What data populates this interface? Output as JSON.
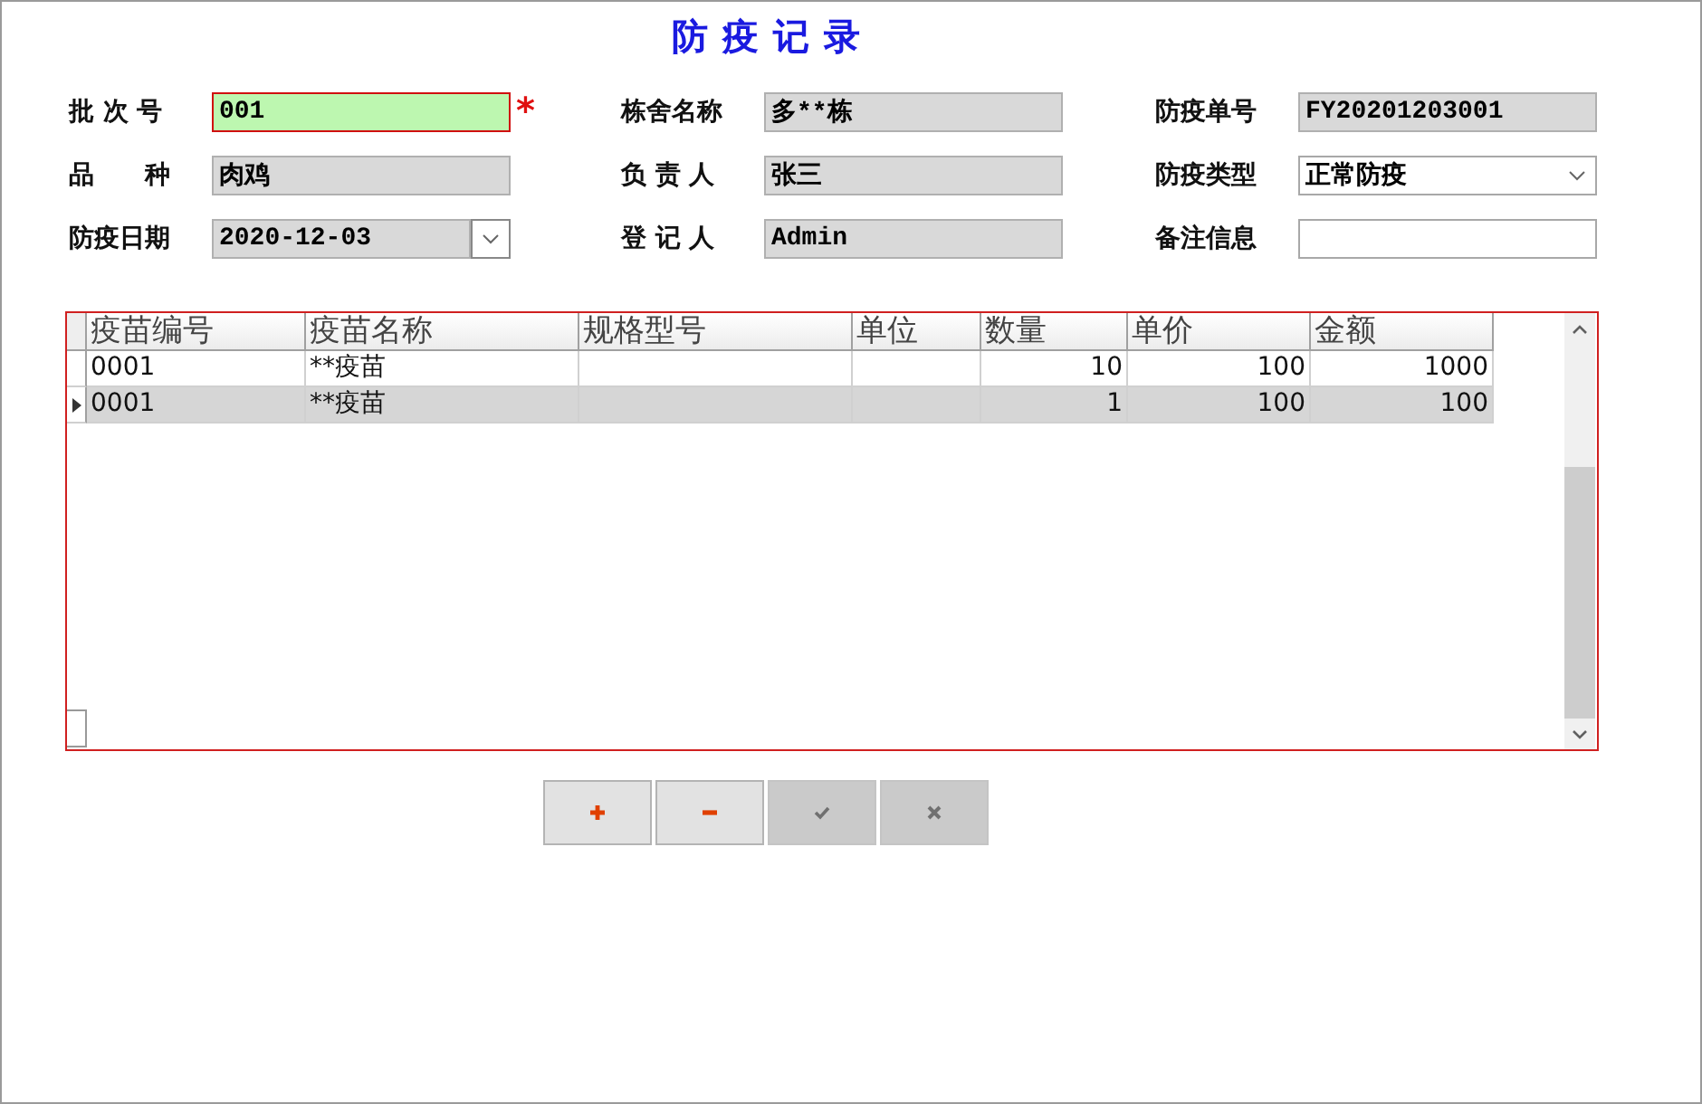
{
  "window": {
    "title": "防疫记录"
  },
  "form": {
    "fields": [
      {
        "label": "批 次 号",
        "kind": "text",
        "value": "001",
        "focused": true,
        "readonly": false,
        "mark": "*"
      },
      {
        "label": "栋舍名称",
        "kind": "text",
        "value": "多**栋",
        "focused": false,
        "readonly": true
      },
      {
        "label": "防疫单号",
        "kind": "text",
        "value": "FY20201203001",
        "focused": false,
        "readonly": true
      },
      {
        "label": "品　　种",
        "kind": "text",
        "value": "肉鸡",
        "focused": false,
        "readonly": true
      },
      {
        "label": "负 责 人",
        "kind": "text",
        "value": "张三",
        "focused": false,
        "readonly": true
      },
      {
        "label": "防疫类型",
        "kind": "combo",
        "value": "正常防疫",
        "focused": false,
        "readonly": false
      },
      {
        "label": "防疫日期",
        "kind": "date",
        "value": "2020-12-03",
        "focused": false,
        "readonly": true
      },
      {
        "label": "登 记 人",
        "kind": "text",
        "value": "Admin",
        "focused": false,
        "readonly": true
      },
      {
        "label": "备注信息",
        "kind": "text",
        "focused": false,
        "readonly": false
      }
    ]
  },
  "grid": {
    "columns": [
      {
        "label": "疫苗编号",
        "kind": "text"
      },
      {
        "label": "疫苗名称",
        "kind": "text"
      },
      {
        "label": "规格型号",
        "kind": "text"
      },
      {
        "label": "单位",
        "kind": "text"
      },
      {
        "label": "数量",
        "kind": "number"
      },
      {
        "label": "单价",
        "kind": "number"
      },
      {
        "label": "金额",
        "kind": "number"
      }
    ],
    "rows": [
      {
        "cells": [
          "0001",
          "**疫苗",
          null,
          null,
          "10",
          "100",
          "1000"
        ],
        "selected": false
      },
      {
        "cells": [
          "0001",
          "**疫苗",
          null,
          null,
          "1",
          "100",
          "100"
        ],
        "selected": true
      }
    ]
  },
  "buttons": [
    {
      "kind": "add",
      "disabled": false
    },
    {
      "kind": "remove",
      "disabled": false
    },
    {
      "kind": "confirm",
      "disabled": true
    },
    {
      "kind": "cancel",
      "disabled": true
    }
  ]
}
